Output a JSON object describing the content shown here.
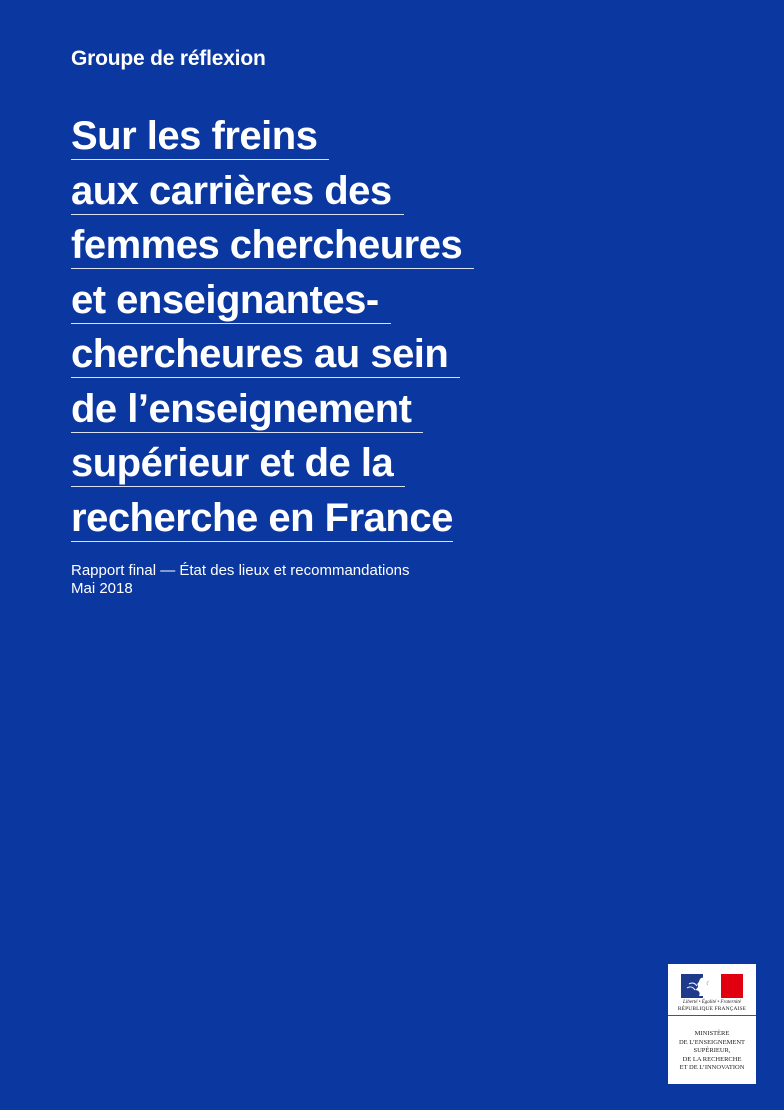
{
  "kicker": "Groupe de réflexion",
  "title_lines": [
    "Sur les freins",
    "aux carrières des",
    "femmes chercheures",
    "et enseignantes-",
    "chercheures au sein",
    "de l’enseignement",
    "supérieur et de la",
    "recherche en France"
  ],
  "subtitle": {
    "line1": "Rapport final — État des lieux et recommandations",
    "line2": "Mai 2018"
  },
  "logo": {
    "motto": "Liberté • Égalité • Fraternité",
    "republic": "RÉPUBLIQUE FRANÇAISE",
    "ministry": "MINISTÈRE\nDE L’ENSEIGNEMENT\nSUPÉRIEUR,\nDE LA RECHERCHE\nET DE L’INNOVATION"
  },
  "colors": {
    "background": "#0b37a0",
    "text": "#ffffff",
    "flag_blue": "#1f3a8a",
    "flag_red": "#e1000f"
  }
}
